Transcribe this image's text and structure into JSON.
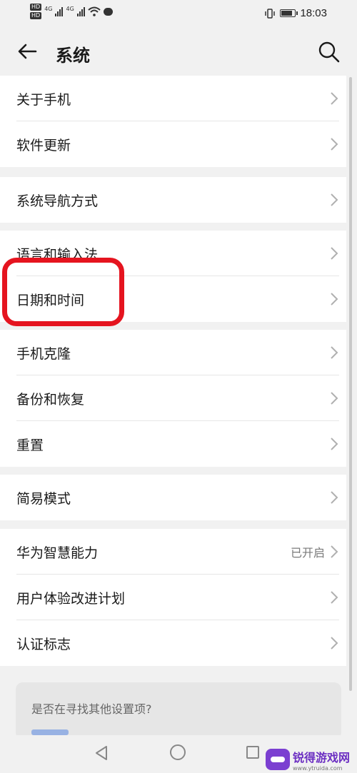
{
  "status_bar": {
    "hd1": "HD",
    "hd2": "HD",
    "net1": "4G",
    "net2": "4G",
    "time": "18:03"
  },
  "header": {
    "title": "系统"
  },
  "groups": [
    {
      "items": [
        {
          "label": "关于手机"
        },
        {
          "label": "软件更新"
        }
      ]
    },
    {
      "items": [
        {
          "label": "系统导航方式"
        }
      ]
    },
    {
      "items": [
        {
          "label": "语言和输入法"
        },
        {
          "label": "日期和时间"
        }
      ]
    },
    {
      "items": [
        {
          "label": "手机克隆"
        },
        {
          "label": "备份和恢复"
        },
        {
          "label": "重置"
        }
      ]
    },
    {
      "items": [
        {
          "label": "简易模式"
        }
      ]
    },
    {
      "items": [
        {
          "label": "华为智慧能力",
          "status": "已开启"
        },
        {
          "label": "用户体验改进计划"
        },
        {
          "label": "认证标志"
        }
      ]
    }
  ],
  "suggestion": {
    "question": "是否在寻找其他设置项?"
  },
  "watermark": {
    "name": "锐得游戏网",
    "url": "www.ytruida.com"
  },
  "colors": {
    "highlight": "#e5141f",
    "background": "#f1f1f1"
  }
}
